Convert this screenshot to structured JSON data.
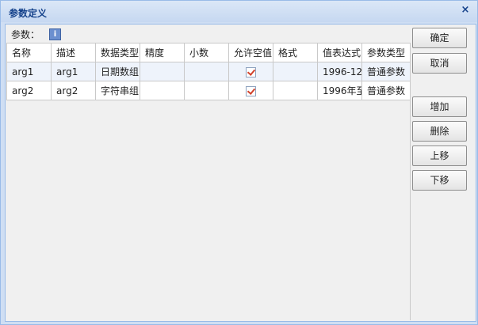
{
  "dialog": {
    "title": "参数定义",
    "close_symbol": "×"
  },
  "params": {
    "label": "参数：",
    "icon": "info-icon"
  },
  "table": {
    "columns": [
      "名称",
      "描述",
      "数据类型",
      "精度",
      "小数",
      "允许空值",
      "格式",
      "值表达式",
      "参数类型"
    ],
    "rows": [
      {
        "name": "arg1",
        "desc": "arg1",
        "dtype": "日期数组",
        "precision": "",
        "decimal": "",
        "nullable": true,
        "format": "",
        "expr": "1996-12",
        "ptype": "普通参数"
      },
      {
        "name": "arg2",
        "desc": "arg2",
        "dtype": "字符串组",
        "precision": "",
        "decimal": "",
        "nullable": true,
        "format": "",
        "expr": "1996年至",
        "ptype": "普通参数"
      }
    ]
  },
  "buttons": {
    "ok": "确定",
    "cancel": "取消",
    "add": "增加",
    "delete": "删除",
    "up": "上移",
    "down": "下移"
  }
}
